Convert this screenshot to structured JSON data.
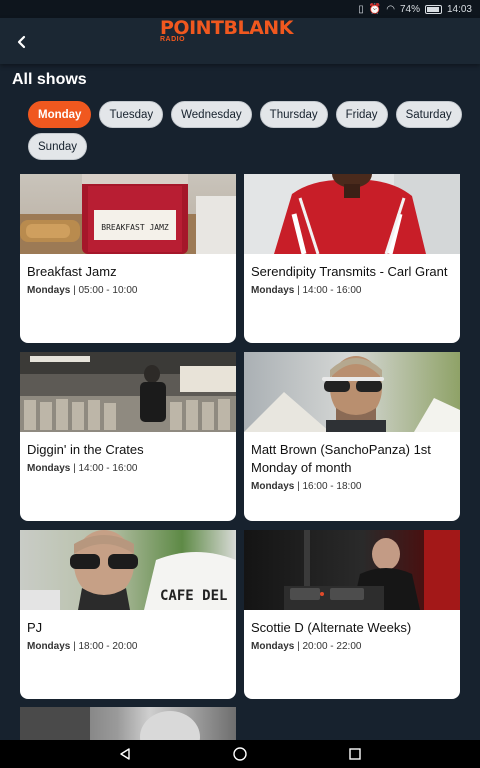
{
  "status_bar": {
    "battery": "74%",
    "time": "14:03",
    "battery_level": 0.74
  },
  "header": {
    "logo_text": "POINTBLANK",
    "logo_sub": "RADIO"
  },
  "section_title": "All shows",
  "days": [
    "Monday",
    "Tuesday",
    "Wednesday",
    "Thursday",
    "Friday",
    "Saturday",
    "Sunday"
  ],
  "selected_day": "Monday",
  "shows": [
    {
      "title": "Breakfast Jamz",
      "day": "Mondays",
      "hours": "05:00 - 10:00",
      "image_text": "BREAKFAST JAMZ"
    },
    {
      "title": "Serendipity Transmits - Carl Grant",
      "day": "Mondays",
      "hours": "14:00 - 16:00"
    },
    {
      "title": "Diggin' in the Crates",
      "day": "Mondays",
      "hours": "14:00 - 16:00"
    },
    {
      "title": "Matt Brown (SanchoPanza) 1st Monday of month",
      "day": "Mondays",
      "hours": "16:00 - 18:00"
    },
    {
      "title": "PJ",
      "day": "Mondays",
      "hours": "18:00 - 20:00",
      "image_text": "CAFE DEL"
    },
    {
      "title": "Scottie D (Alternate Weeks)",
      "day": "Mondays",
      "hours": "20:00 - 22:00"
    }
  ],
  "colors": {
    "accent": "#f0581f",
    "background": "#17222e",
    "chip": "#e3e6e9"
  }
}
